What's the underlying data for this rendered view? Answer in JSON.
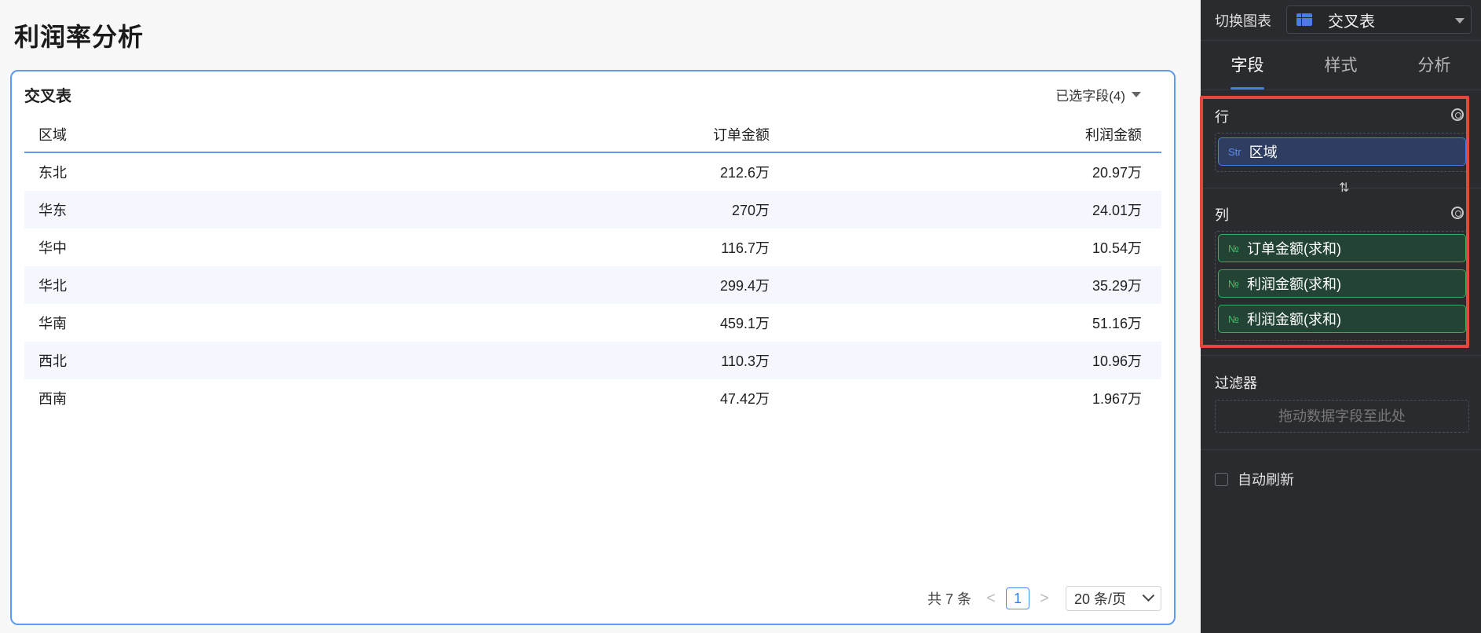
{
  "page": {
    "title": "利润率分析"
  },
  "card": {
    "title": "交叉表",
    "selected_fields": "已选字段(4)"
  },
  "table": {
    "headers": {
      "region": "区域",
      "order": "订单金额",
      "profit": "利润金额"
    },
    "rows": [
      {
        "region": "东北",
        "order": "212.6万",
        "profit": "20.97万"
      },
      {
        "region": "华东",
        "order": "270万",
        "profit": "24.01万"
      },
      {
        "region": "华中",
        "order": "116.7万",
        "profit": "10.54万"
      },
      {
        "region": "华北",
        "order": "299.4万",
        "profit": "35.29万"
      },
      {
        "region": "华南",
        "order": "459.1万",
        "profit": "51.16万"
      },
      {
        "region": "西北",
        "order": "110.3万",
        "profit": "10.96万"
      },
      {
        "region": "西南",
        "order": "47.42万",
        "profit": "1.967万"
      }
    ]
  },
  "pagination": {
    "total": "共 7 条",
    "prev": "<",
    "current": "1",
    "next": ">",
    "page_size": "20 条/页"
  },
  "panel": {
    "switch_label": "切换图表",
    "switch_value": "交叉表",
    "tabs": [
      {
        "label": "字段",
        "active": true
      },
      {
        "label": "样式",
        "active": false
      },
      {
        "label": "分析",
        "active": false
      }
    ],
    "rows_section": {
      "label": "行",
      "fields": [
        {
          "type": "Str",
          "name": "区域"
        }
      ]
    },
    "swap_icon": "⇅",
    "cols_section": {
      "label": "列",
      "fields": [
        {
          "type": "№",
          "name": "订单金额(求和)"
        },
        {
          "type": "№",
          "name": "利润金额(求和)"
        },
        {
          "type": "№",
          "name": "利润金额(求和)"
        }
      ]
    },
    "filter": {
      "label": "过滤器",
      "placeholder": "拖动数据字段至此处"
    },
    "auto_refresh": "自动刷新"
  },
  "colors": {
    "accent": "#4a7be8",
    "highlight": "#e5473e",
    "panel_bg": "#2a2b2f",
    "card_border": "#5b9cf2"
  }
}
